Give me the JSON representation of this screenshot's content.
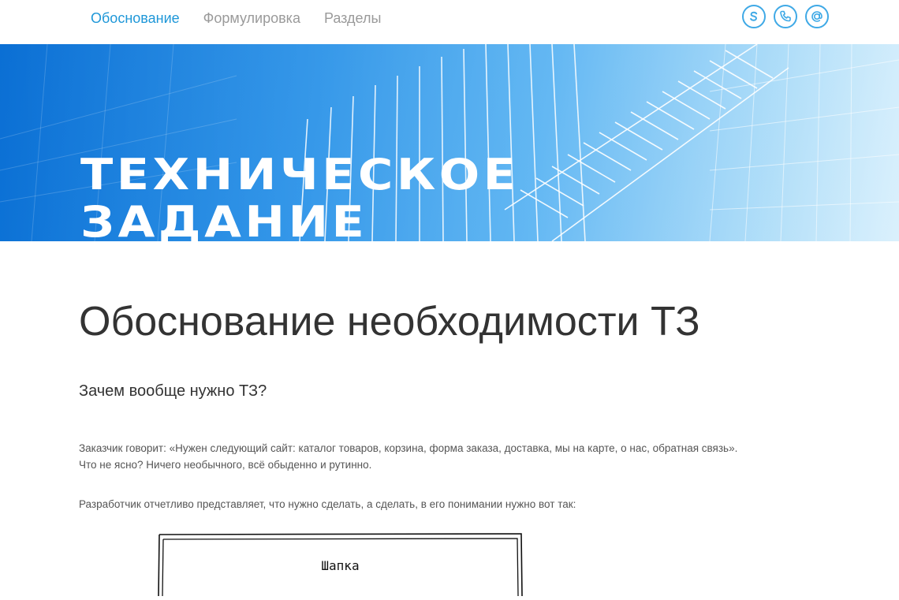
{
  "nav": {
    "items": [
      {
        "label": "Обоснование",
        "active": true
      },
      {
        "label": "Формулировка",
        "active": false
      },
      {
        "label": "Разделы",
        "active": false
      }
    ]
  },
  "contacts": [
    {
      "icon": "skype-icon"
    },
    {
      "icon": "phone-icon"
    },
    {
      "icon": "email-icon"
    }
  ],
  "hero": {
    "title_line1": "Техническое",
    "title_line2": "Задание"
  },
  "main": {
    "title": "Обоснование необходимости ТЗ",
    "subtitle": "Зачем вообще нужно ТЗ?",
    "paragraph1_line1": "Заказчик говорит: «Нужен следующий сайт: каталог товаров, корзина, форма заказа, доставка, мы на карте, о нас, обратная связь».",
    "paragraph1_line2": "Что не ясно? Ничего необычного, всё обыденно и рутинно.",
    "paragraph2": "Разработчик отчетливо представляет, что нужно сделать, а сделать, в его понимании нужно вот так:",
    "sketch_label": "Шапка"
  },
  "colors": {
    "accent": "#1e97d8",
    "icon_border": "#3fa9e6",
    "nav_inactive": "#9a9a9a",
    "text_dark": "#333333"
  }
}
